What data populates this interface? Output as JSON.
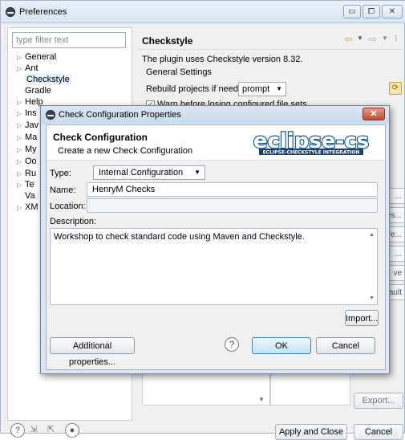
{
  "window": {
    "title": "Preferences",
    "controls": [
      "▭",
      "⧠",
      "✕"
    ]
  },
  "sidebar": {
    "filter_placeholder": "type filter text",
    "items": [
      {
        "label": "General",
        "expandable": true
      },
      {
        "label": "Ant",
        "expandable": true
      },
      {
        "label": "Checkstyle",
        "expandable": false,
        "selected": true
      },
      {
        "label": "Gradle",
        "expandable": false
      },
      {
        "label": "Help",
        "expandable": true
      },
      {
        "label": "Ins",
        "expandable": true
      },
      {
        "label": "Jav",
        "expandable": true
      },
      {
        "label": "Ma",
        "expandable": true
      },
      {
        "label": "My",
        "expandable": true
      },
      {
        "label": "Oo",
        "expandable": true
      },
      {
        "label": "Ru",
        "expandable": true
      },
      {
        "label": "Te",
        "expandable": true
      },
      {
        "label": "Va",
        "expandable": false
      },
      {
        "label": "XM",
        "expandable": true
      }
    ]
  },
  "main": {
    "title": "Checkstyle",
    "version_text": "The plugin uses Checkstyle version 8.32.",
    "general_settings": "General Settings",
    "rebuild_label": "Rebuild projects if needed:",
    "rebuild_value": "prompt",
    "warn_label": "Warn before losing configured file sets",
    "side_buttons": [
      "...",
      "es...",
      "re...",
      "...",
      "ve",
      "fault"
    ],
    "export_label": "Export..."
  },
  "bottom": {
    "apply_close_label": "Apply and Close",
    "cancel_label": "Cancel"
  },
  "dialog": {
    "title": "Check Configuration Properties",
    "close": "✕",
    "header_title": "Check Configuration",
    "header_subtitle": "Create a new Check Configuration",
    "logo_text": "eclipse-cs",
    "logo_subtext": "ECLIPSE-CHECKSTYLE INTEGRATION",
    "type_label": "Type:",
    "type_value": "Internal Configuration",
    "name_label": "Name:",
    "name_value": "HenryM Checks",
    "location_label": "Location:",
    "location_value": "",
    "description_label": "Description:",
    "description_value": "Workshop to check standard code using Maven and Checkstyle.",
    "import_label": "Import...",
    "additional_label": "Additional properties...",
    "ok_label": "OK",
    "cancel_label": "Cancel"
  },
  "colors": {
    "title_bar": "#d7e4f3",
    "dialog_border": "#6f86a3",
    "ok_border": "#3c7fb1",
    "logo_text": "#1d5e9c"
  }
}
